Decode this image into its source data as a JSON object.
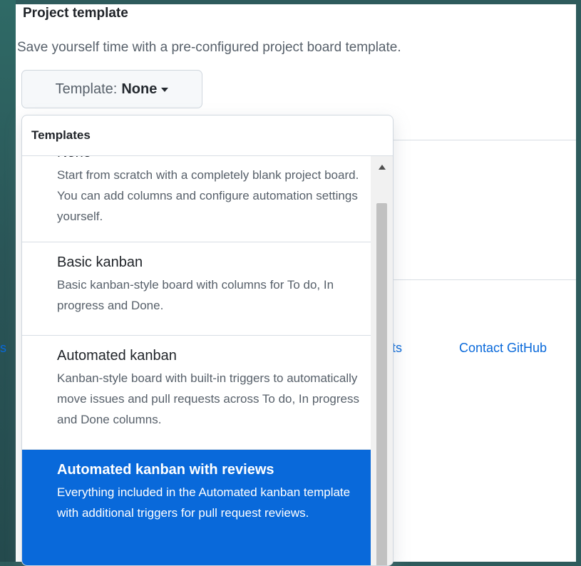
{
  "section": {
    "title": "Project template",
    "description": "Save yourself time with a pre-configured project board template."
  },
  "template_button": {
    "prefix": "Template:",
    "value": "None"
  },
  "dropdown": {
    "header": "Templates",
    "items": [
      {
        "name": "None",
        "description": "Start from scratch with a completely blank project board. You can add columns and configure automation settings yourself."
      },
      {
        "name": "Basic kanban",
        "description": "Basic kanban-style board with columns for To do, In progress and Done."
      },
      {
        "name": "Automated kanban",
        "description": "Kanban-style board with built-in triggers to automatically move issues and pull requests across To do, In progress and Done columns."
      },
      {
        "name": "Automated kanban with reviews",
        "description": "Everything included in the Automated kanban template with additional triggers for pull request reviews.",
        "selected": true
      }
    ]
  },
  "footer": {
    "edge_fragment": "s",
    "stats_fragment": "ts",
    "contact": "Contact GitHub"
  },
  "colors": {
    "accent": "#0969da",
    "background": "#2e5b5c"
  }
}
